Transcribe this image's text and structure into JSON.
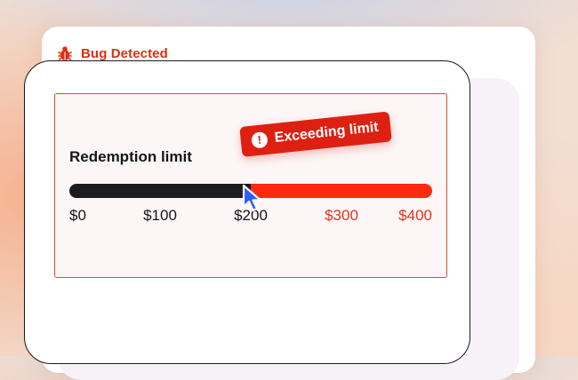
{
  "card": {
    "title": "Bug Detected",
    "icon": "bug-icon",
    "accent": "#e12d12"
  },
  "slider": {
    "label": "Redemption limit",
    "value": 200,
    "min": 0,
    "max": 400,
    "colors": {
      "filled": "#1b1b20",
      "exceeded": "#ff2a0f"
    },
    "ticks": [
      {
        "label": "$0",
        "value": 0,
        "exceeded": false
      },
      {
        "label": "$100",
        "value": 100,
        "exceeded": false
      },
      {
        "label": "$200",
        "value": 200,
        "exceeded": false
      },
      {
        "label": "$300",
        "value": 300,
        "exceeded": true
      },
      {
        "label": "$400",
        "value": 400,
        "exceeded": true
      }
    ]
  },
  "tooltip": {
    "text": "Exceeding limit",
    "icon": "warning-icon"
  },
  "cursor": {
    "icon": "pointer-cursor-icon"
  }
}
